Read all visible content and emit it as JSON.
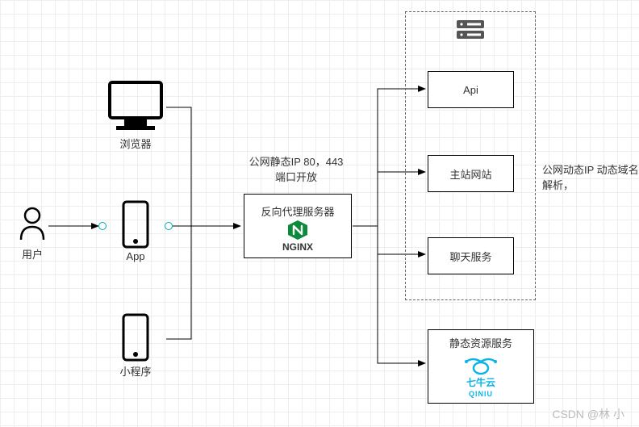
{
  "user": {
    "label": "用户"
  },
  "browser": {
    "label": "浏览器"
  },
  "app": {
    "label": "App"
  },
  "miniapp": {
    "label": "小程序"
  },
  "proxy": {
    "title": "反向代理服务器",
    "caption": "NGINX",
    "note": "公网静态IP 80，443\n端口开放"
  },
  "backend": {
    "api": "Api",
    "site": "主站网站",
    "chat": "聊天服务",
    "note": "公网动态IP 动态域名\n解析，"
  },
  "static": {
    "title": "静态资源服务",
    "brand": "七牛云",
    "brand_en": "QINIU"
  },
  "watermark": "CSDN @林 小"
}
